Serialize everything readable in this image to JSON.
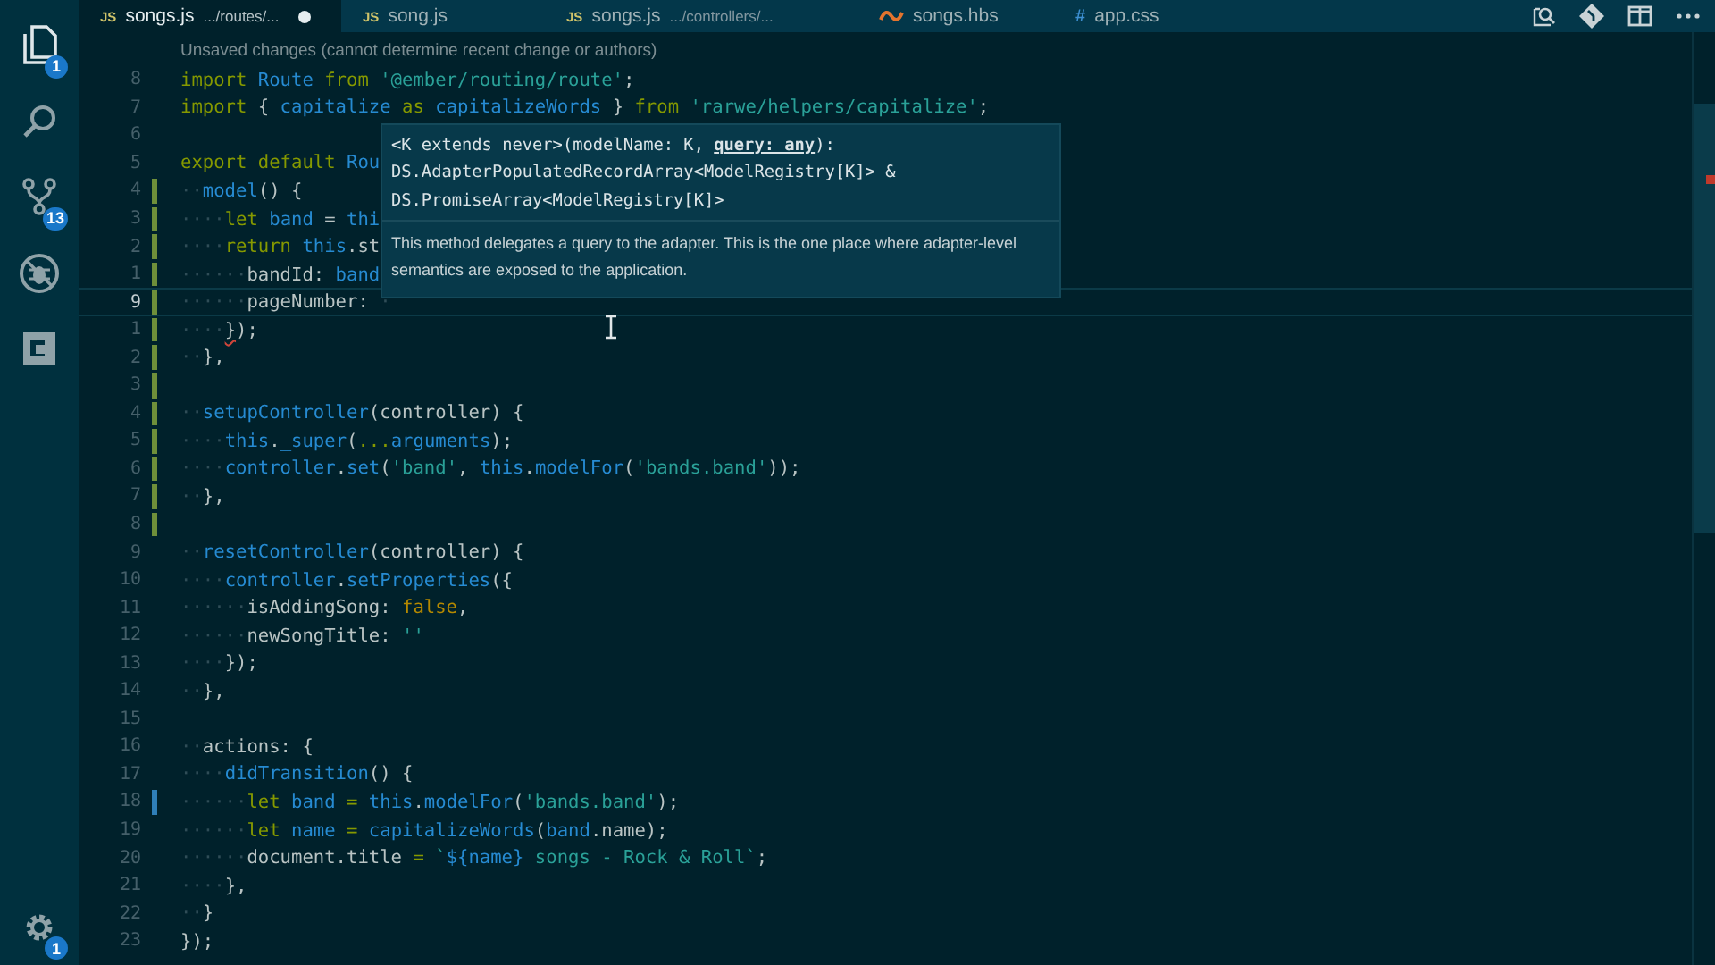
{
  "activity_bar": {
    "items": [
      {
        "kind": "files",
        "badge": "1",
        "selected": true
      },
      {
        "kind": "search",
        "selected": false
      },
      {
        "kind": "source-control",
        "badge": "13",
        "selected": false
      },
      {
        "kind": "debug",
        "selected": false
      },
      {
        "kind": "extensions",
        "selected": false
      }
    ],
    "manage": {
      "kind": "gear",
      "badge": "1"
    }
  },
  "tabs": [
    {
      "kind": "js",
      "icon_text": "JS",
      "label": "songs.js",
      "path": ".../routes/...",
      "dirty": true,
      "selected": true
    },
    {
      "kind": "js",
      "icon_text": "JS",
      "label": "song.js",
      "dirty": false,
      "selected": false
    },
    {
      "kind": "js",
      "icon_text": "JS",
      "label": "songs.js",
      "path": ".../controllers/...",
      "dirty": false,
      "selected": false
    },
    {
      "kind": "hbs",
      "label": "songs.hbs",
      "dirty": false,
      "selected": false
    },
    {
      "kind": "css",
      "icon_text": "#",
      "label": "app.css",
      "dirty": false,
      "selected": false
    }
  ],
  "toolbar": [
    {
      "kind": "open-changes"
    },
    {
      "kind": "git"
    },
    {
      "kind": "split"
    },
    {
      "kind": "more"
    }
  ],
  "blame": "Unsaved changes (cannot determine recent change or authors)",
  "lines": [
    {
      "number": "8",
      "added": false,
      "modified": false,
      "tokens": [
        {
          "kind": "kw",
          "text": "import"
        },
        {
          "kind": "id",
          "text": " Route"
        },
        {
          "kind": "kw",
          "text": " from"
        },
        {
          "kind": "str",
          "text": " '@ember/routing/route'"
        },
        {
          "kind": "p",
          "text": ";"
        }
      ]
    },
    {
      "number": "7",
      "added": false,
      "modified": false,
      "tokens": [
        {
          "kind": "kw",
          "text": "import"
        },
        {
          "kind": "p",
          "text": " {"
        },
        {
          "kind": "id",
          "text": " capitalize"
        },
        {
          "kind": "kw",
          "text": " as"
        },
        {
          "kind": "id",
          "text": " capitalizeWords"
        },
        {
          "kind": "p",
          "text": " }"
        },
        {
          "kind": "kw",
          "text": " from"
        },
        {
          "kind": "str",
          "text": " 'rarwe/helpers/capitalize'"
        },
        {
          "kind": "p",
          "text": ";"
        }
      ]
    },
    {
      "number": "6",
      "added": false,
      "modified": false
    },
    {
      "number": "5",
      "added": false,
      "modified": false,
      "tokens": [
        {
          "kind": "kw",
          "text": "export default"
        },
        {
          "kind": "id",
          "text": " Rou"
        }
      ]
    },
    {
      "number": "4",
      "added": true,
      "modified": false,
      "tokens": [
        {
          "kind": "ws",
          "text": "··"
        },
        {
          "kind": "fn",
          "text": "model"
        },
        {
          "kind": "p",
          "text": "() {"
        }
      ]
    },
    {
      "number": "3",
      "added": true,
      "modified": false,
      "tokens": [
        {
          "kind": "ws",
          "text": "····"
        },
        {
          "kind": "kw",
          "text": "let"
        },
        {
          "kind": "id",
          "text": " band"
        },
        {
          "kind": "p",
          "text": " ="
        },
        {
          "kind": "id",
          "text": " thi"
        }
      ]
    },
    {
      "number": "2",
      "added": true,
      "modified": false,
      "tokens": [
        {
          "kind": "ws",
          "text": "····"
        },
        {
          "kind": "kw",
          "text": "return"
        },
        {
          "kind": "id",
          "text": " this"
        },
        {
          "kind": "p",
          "text": ".st"
        }
      ]
    },
    {
      "number": "1",
      "added": true,
      "modified": false,
      "tokens": [
        {
          "kind": "ws",
          "text": "······"
        },
        {
          "kind": "p",
          "text": "bandId:"
        },
        {
          "kind": "id",
          "text": " band"
        }
      ]
    },
    {
      "number": "9",
      "added": true,
      "modified": false,
      "current": true,
      "tokens": [
        {
          "kind": "ws",
          "text": "······"
        },
        {
          "kind": "p",
          "text": "pageNumber:"
        },
        {
          "kind": "ws",
          "text": " ·"
        }
      ]
    },
    {
      "number": "1",
      "added": true,
      "modified": false,
      "tokens": [
        {
          "kind": "ws",
          "text": "····"
        },
        {
          "kind": "p",
          "text": "}",
          "error": true
        },
        {
          "kind": "p",
          "text": ");"
        }
      ]
    },
    {
      "number": "2",
      "added": true,
      "modified": false,
      "tokens": [
        {
          "kind": "ws",
          "text": "··"
        },
        {
          "kind": "p",
          "text": "},"
        }
      ]
    },
    {
      "number": "3",
      "added": true,
      "modified": false
    },
    {
      "number": "4",
      "added": true,
      "modified": false,
      "tokens": [
        {
          "kind": "ws",
          "text": "··"
        },
        {
          "kind": "fn",
          "text": "setupController"
        },
        {
          "kind": "p",
          "text": "(controller) {"
        }
      ]
    },
    {
      "number": "5",
      "added": true,
      "modified": false,
      "tokens": [
        {
          "kind": "ws",
          "text": "····"
        },
        {
          "kind": "id",
          "text": "this"
        },
        {
          "kind": "p",
          "text": "."
        },
        {
          "kind": "fn",
          "text": "_super"
        },
        {
          "kind": "p",
          "text": "("
        },
        {
          "kind": "kw",
          "text": "..."
        },
        {
          "kind": "fn",
          "text": "arguments"
        },
        {
          "kind": "p",
          "text": ");"
        }
      ]
    },
    {
      "number": "6",
      "added": true,
      "modified": false,
      "tokens": [
        {
          "kind": "ws",
          "text": "····"
        },
        {
          "kind": "id",
          "text": "controller"
        },
        {
          "kind": "p",
          "text": "."
        },
        {
          "kind": "fn",
          "text": "set"
        },
        {
          "kind": "p",
          "text": "("
        },
        {
          "kind": "str",
          "text": "'band'"
        },
        {
          "kind": "p",
          "text": ","
        },
        {
          "kind": "id",
          "text": " this"
        },
        {
          "kind": "p",
          "text": "."
        },
        {
          "kind": "fn",
          "text": "modelFor"
        },
        {
          "kind": "p",
          "text": "("
        },
        {
          "kind": "str",
          "text": "'bands.band'"
        },
        {
          "kind": "p",
          "text": "));"
        }
      ]
    },
    {
      "number": "7",
      "added": true,
      "modified": false,
      "tokens": [
        {
          "kind": "ws",
          "text": "··"
        },
        {
          "kind": "p",
          "text": "},"
        }
      ]
    },
    {
      "number": "8",
      "added": true,
      "modified": false
    },
    {
      "number": "9",
      "added": false,
      "modified": false,
      "tokens": [
        {
          "kind": "ws",
          "text": "··"
        },
        {
          "kind": "fn",
          "text": "resetController"
        },
        {
          "kind": "p",
          "text": "(controller) {"
        }
      ]
    },
    {
      "number": "10",
      "added": false,
      "modified": false,
      "tokens": [
        {
          "kind": "ws",
          "text": "····"
        },
        {
          "kind": "id",
          "text": "controller"
        },
        {
          "kind": "p",
          "text": "."
        },
        {
          "kind": "fn",
          "text": "setProperties"
        },
        {
          "kind": "p",
          "text": "({"
        }
      ]
    },
    {
      "number": "11",
      "added": false,
      "modified": false,
      "tokens": [
        {
          "kind": "ws",
          "text": "······"
        },
        {
          "kind": "p",
          "text": "isAddingSong:"
        },
        {
          "kind": "bool",
          "text": " false"
        },
        {
          "kind": "p",
          "text": ","
        }
      ]
    },
    {
      "number": "12",
      "added": false,
      "modified": false,
      "tokens": [
        {
          "kind": "ws",
          "text": "······"
        },
        {
          "kind": "p",
          "text": "newSongTitle:"
        },
        {
          "kind": "str",
          "text": " ''"
        }
      ]
    },
    {
      "number": "13",
      "added": false,
      "modified": false,
      "tokens": [
        {
          "kind": "ws",
          "text": "····"
        },
        {
          "kind": "p",
          "text": "});"
        }
      ]
    },
    {
      "number": "14",
      "added": false,
      "modified": false,
      "tokens": [
        {
          "kind": "ws",
          "text": "··"
        },
        {
          "kind": "p",
          "text": "},"
        }
      ]
    },
    {
      "number": "15",
      "added": false,
      "modified": false
    },
    {
      "number": "16",
      "added": false,
      "modified": false,
      "tokens": [
        {
          "kind": "ws",
          "text": "··"
        },
        {
          "kind": "p",
          "text": "actions: {"
        }
      ]
    },
    {
      "number": "17",
      "added": false,
      "modified": false,
      "tokens": [
        {
          "kind": "ws",
          "text": "····"
        },
        {
          "kind": "fn",
          "text": "didTransition"
        },
        {
          "kind": "p",
          "text": "() {"
        }
      ]
    },
    {
      "number": "18",
      "added": false,
      "modified": true,
      "tokens": [
        {
          "kind": "ws",
          "text": "······"
        },
        {
          "kind": "kw",
          "text": "let"
        },
        {
          "kind": "id",
          "text": " band"
        },
        {
          "kind": "kw",
          "text": " ="
        },
        {
          "kind": "id",
          "text": " this"
        },
        {
          "kind": "p",
          "text": "."
        },
        {
          "kind": "fn",
          "text": "modelFor"
        },
        {
          "kind": "p",
          "text": "("
        },
        {
          "kind": "str",
          "text": "'bands.band'"
        },
        {
          "kind": "p",
          "text": ");"
        }
      ]
    },
    {
      "number": "19",
      "added": false,
      "modified": false,
      "tokens": [
        {
          "kind": "ws",
          "text": "······"
        },
        {
          "kind": "kw",
          "text": "let"
        },
        {
          "kind": "id",
          "text": " name"
        },
        {
          "kind": "kw",
          "text": " ="
        },
        {
          "kind": "fn",
          "text": " capitalizeWords"
        },
        {
          "kind": "p",
          "text": "("
        },
        {
          "kind": "id",
          "text": "band"
        },
        {
          "kind": "p",
          "text": ".name);"
        }
      ]
    },
    {
      "number": "20",
      "added": false,
      "modified": false,
      "tokens": [
        {
          "kind": "ws",
          "text": "······"
        },
        {
          "kind": "p",
          "text": "document.title"
        },
        {
          "kind": "kw",
          "text": " ="
        },
        {
          "kind": "str",
          "text": " `"
        },
        {
          "kind": "id",
          "text": "${name}"
        },
        {
          "kind": "str",
          "text": " songs - Rock & Roll`"
        },
        {
          "kind": "p",
          "text": ";"
        }
      ]
    },
    {
      "number": "21",
      "added": false,
      "modified": false,
      "tokens": [
        {
          "kind": "ws",
          "text": "····"
        },
        {
          "kind": "p",
          "text": "},"
        }
      ]
    },
    {
      "number": "22",
      "added": false,
      "modified": false,
      "tokens": [
        {
          "kind": "ws",
          "text": "··"
        },
        {
          "kind": "p",
          "text": "}"
        }
      ]
    },
    {
      "number": "23",
      "added": false,
      "modified": false,
      "tokens": [
        {
          "kind": "p",
          "text": "});"
        }
      ]
    }
  ],
  "hover": {
    "signature": [
      "<K extends never>(modelName: K, **query: any**):",
      "DS.AdapterPopulatedRecordArray<ModelRegistry[K]> &",
      "DS.PromiseArray<ModelRegistry[K]>"
    ],
    "description": "This method delegates a query to the adapter. This is the one place where adapter-level semantics are exposed to the application."
  }
}
